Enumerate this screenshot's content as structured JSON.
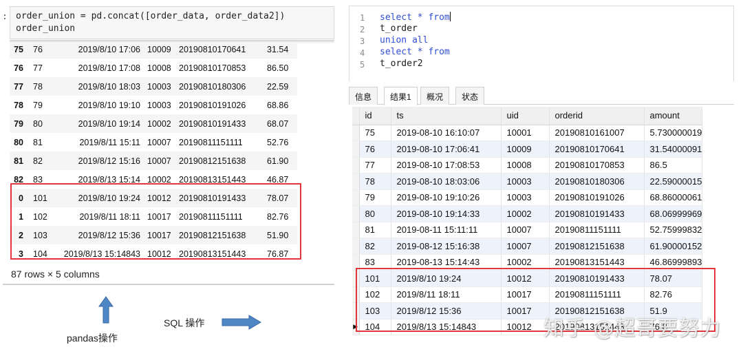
{
  "notebook": {
    "prompt": ":",
    "code_lines": [
      "order_union = pd.concat([order_data, order_data2])",
      "order_union"
    ],
    "rows": [
      {
        "index": "75",
        "id": "76",
        "ts": "2019/8/10 17:06",
        "uid": "10009",
        "orderid": "20190810170641",
        "amount": "31.54"
      },
      {
        "index": "76",
        "id": "77",
        "ts": "2019/8/10 17:08",
        "uid": "10008",
        "orderid": "20190810170853",
        "amount": "86.50"
      },
      {
        "index": "77",
        "id": "78",
        "ts": "2019/8/10 18:03",
        "uid": "10003",
        "orderid": "20190810180306",
        "amount": "22.59"
      },
      {
        "index": "78",
        "id": "79",
        "ts": "2019/8/10 19:10",
        "uid": "10003",
        "orderid": "20190810191026",
        "amount": "68.86"
      },
      {
        "index": "79",
        "id": "80",
        "ts": "2019/8/10 19:14",
        "uid": "10002",
        "orderid": "20190810191433",
        "amount": "68.07"
      },
      {
        "index": "80",
        "id": "81",
        "ts": "2019/8/11 15:11",
        "uid": "10007",
        "orderid": "20190811151111",
        "amount": "52.76"
      },
      {
        "index": "81",
        "id": "82",
        "ts": "2019/8/12 15:16",
        "uid": "10007",
        "orderid": "20190812151638",
        "amount": "61.90"
      },
      {
        "index": "82",
        "id": "83",
        "ts": "2019/8/13 15:14",
        "uid": "10002",
        "orderid": "20190813151443",
        "amount": "46.87"
      },
      {
        "index": "0",
        "id": "101",
        "ts": "2019/8/10 19:24",
        "uid": "10012",
        "orderid": "20190810191433",
        "amount": "78.07"
      },
      {
        "index": "1",
        "id": "102",
        "ts": "2019/8/11 18:11",
        "uid": "10017",
        "orderid": "20190811151111",
        "amount": "82.76"
      },
      {
        "index": "2",
        "id": "103",
        "ts": "2019/8/12 15:36",
        "uid": "10017",
        "orderid": "20190812151638",
        "amount": "51.90"
      },
      {
        "index": "3",
        "id": "104",
        "ts": "2019/8/13 15:14843",
        "uid": "10012",
        "orderid": "20190813151443",
        "amount": "76.87"
      }
    ],
    "summary": "87 rows × 5 columns"
  },
  "captions": {
    "pandas": "pandas操作",
    "sql": "SQL 操作"
  },
  "sql_editor": {
    "lines": [
      {
        "num": "1",
        "text": "select * from",
        "keyword": true,
        "cursor": true
      },
      {
        "num": "2",
        "text": "t_order",
        "keyword": false
      },
      {
        "num": "3",
        "text": "union all",
        "keyword": true
      },
      {
        "num": "4",
        "text": "select * from",
        "keyword": true
      },
      {
        "num": "5",
        "text": "t_order2",
        "keyword": false
      }
    ]
  },
  "result_tabs": [
    "信息",
    "结果1",
    "概况",
    "状态"
  ],
  "result_grid": {
    "columns": [
      "id",
      "ts",
      "uid",
      "orderid",
      "amount"
    ],
    "rows": [
      {
        "id": "75",
        "ts": "2019-08-10 16:10:07",
        "uid": "10001",
        "orderid": "20190810161007",
        "amount": "5.730000019"
      },
      {
        "id": "76",
        "ts": "2019-08-10 17:06:41",
        "uid": "10009",
        "orderid": "20190810170641",
        "amount": "31.54000091"
      },
      {
        "id": "77",
        "ts": "2019-08-10 17:08:53",
        "uid": "10008",
        "orderid": "20190810170853",
        "amount": "86.5"
      },
      {
        "id": "78",
        "ts": "2019-08-10 18:03:06",
        "uid": "10003",
        "orderid": "20190810180306",
        "amount": "22.59000015"
      },
      {
        "id": "79",
        "ts": "2019-08-10 19:10:26",
        "uid": "10003",
        "orderid": "20190810191026",
        "amount": "68.86000061"
      },
      {
        "id": "80",
        "ts": "2019-08-10 19:14:33",
        "uid": "10002",
        "orderid": "20190810191433",
        "amount": "68.06999969"
      },
      {
        "id": "81",
        "ts": "2019-08-11 15:11:11",
        "uid": "10007",
        "orderid": "20190811151111",
        "amount": "52.75999832"
      },
      {
        "id": "82",
        "ts": "2019-08-12 15:16:38",
        "uid": "10007",
        "orderid": "20190812151638",
        "amount": "61.90000152"
      },
      {
        "id": "83",
        "ts": "2019-08-13 15:14:43",
        "uid": "10002",
        "orderid": "20190813151443",
        "amount": "46.86999893"
      },
      {
        "id": "101",
        "ts": "2019/8/10 19:24",
        "uid": "10012",
        "orderid": "20190810191433",
        "amount": "78.07"
      },
      {
        "id": "102",
        "ts": "2019/8/11 18:11",
        "uid": "10017",
        "orderid": "20190811151111",
        "amount": "82.76"
      },
      {
        "id": "103",
        "ts": "2019/8/12 15:36",
        "uid": "10017",
        "orderid": "20190812151638",
        "amount": "51.9"
      },
      {
        "id": "104",
        "ts": "2019/8/13  15:14843",
        "uid": "10012",
        "orderid": "20190813151443",
        "amount": "76.8"
      }
    ],
    "current_row_marker": "▶"
  },
  "watermark": "知乎 @超哥要努力",
  "colors": {
    "highlight_border": "#e0363c",
    "arrow_blue": "#4f86c6",
    "sql_keyword": "#2f4dd6"
  },
  "icons": [
    "arrow-up-icon",
    "arrow-right-icon",
    "row-pointer-icon"
  ]
}
